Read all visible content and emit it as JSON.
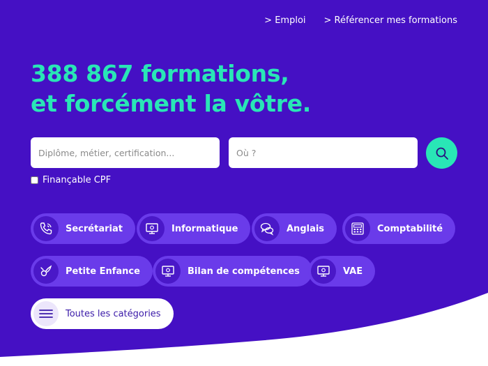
{
  "nav": {
    "emploi": "> Emploi",
    "referencer": "> Référencer mes formations"
  },
  "hero": {
    "line1": "388 867 formations,",
    "line2": "et forcément la vôtre."
  },
  "search": {
    "what_placeholder": "Diplôme, métier, certification...",
    "where_placeholder": "Où ?",
    "cpf_label": "Finançable CPF"
  },
  "categories": [
    {
      "label": "Secrétariat",
      "icon": "phone-icon"
    },
    {
      "label": "Informatique",
      "icon": "computer-icon"
    },
    {
      "label": "Anglais",
      "icon": "speech-bubbles-icon"
    },
    {
      "label": "Comptabilité",
      "icon": "calculator-icon"
    },
    {
      "label": "Petite Enfance",
      "icon": "pacifier-icon"
    },
    {
      "label": "Bilan de compétences",
      "icon": "computer-icon"
    },
    {
      "label": "VAE",
      "icon": "computer-icon"
    }
  ],
  "all_categories": {
    "label": "Toutes les catégories",
    "icon": "menu-icon"
  },
  "colors": {
    "background": "#4510c4",
    "accent": "#29e6b6",
    "chip": "#6a3bea",
    "white": "#ffffff"
  }
}
